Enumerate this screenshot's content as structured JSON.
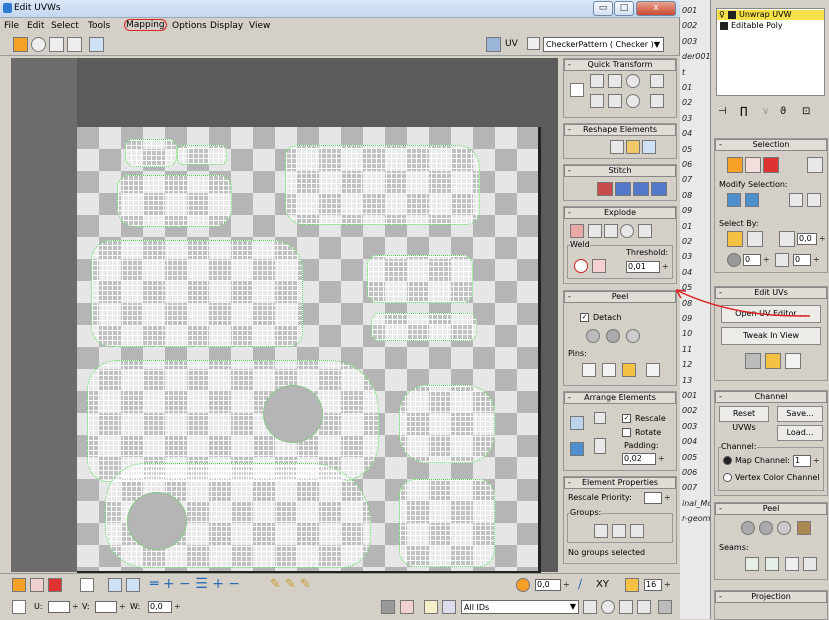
{
  "window": {
    "title": "Edit UVWs",
    "min_label": "▭",
    "max_label": "□",
    "close_label": "x"
  },
  "menu": {
    "items": [
      "File",
      "Edit",
      "Select",
      "Tools",
      "Mapping",
      "Options",
      "Display",
      "View"
    ]
  },
  "toolbar": {
    "uv_label": "UV",
    "pattern_dropdown": "CheckerPattern  ( Checker )"
  },
  "panel": {
    "quick_transform": "Quick Transform",
    "reshape_elements": "Reshape Elements",
    "stitch": "Stitch",
    "explode": "Explode",
    "weld": "Weld",
    "threshold_label": "Threshold:",
    "threshold_value": "0,01",
    "peel": "Peel",
    "detach_label": "Detach",
    "pins_label": "Pins:",
    "arrange_elements": "Arrange Elements",
    "rescale_label": "Rescale",
    "rotate_label": "Rotate",
    "padding_label": "Padding:",
    "padding_value": "0,02",
    "element_properties": "Element Properties",
    "rescale_priority_label": "Rescale Priority:",
    "groups_label": "Groups:",
    "no_groups_label": "No groups selected"
  },
  "bottombar": {
    "spin_value": "0,0",
    "xy_label": "XY",
    "grid_value": "16",
    "u_label": "U:",
    "v_label": "V:",
    "w_label": "W:",
    "w_value": "0,0",
    "ids_dropdown": "All IDs"
  },
  "background_list": {
    "items": [
      "001",
      "002",
      "003",
      "der001",
      "t",
      "01",
      "02",
      "03",
      "04",
      "05",
      "06",
      "07",
      "08",
      "09",
      "01",
      "02",
      "03",
      "04",
      "05",
      "08",
      "09",
      "10",
      "11",
      "12",
      "13",
      "001",
      "002",
      "003",
      "004",
      "005",
      "006",
      "007",
      "inal_Mo",
      "r-geoma"
    ]
  },
  "modifier_panel": {
    "stack": [
      "Unwrap UVW",
      "Editable Poly"
    ],
    "selection_title": "Selection",
    "modify_selection_label": "Modify Selection:",
    "select_by_label": "Select By:",
    "select_by_value1": "0,0",
    "select_by_value2": "0",
    "select_by_value3": "0",
    "edit_uvs_title": "Edit UVs",
    "open_uv_editor_label": "Open UV Editor ...",
    "tweak_in_view_label": "Tweak In View",
    "channel_title": "Channel",
    "reset_uvws_label": "Reset UVWs",
    "save_label": "Save...",
    "load_label": "Load...",
    "channel_group_label": "Channel:",
    "map_channel_label": "Map Channel:",
    "map_channel_value": "1",
    "vertex_color_channel_label": "Vertex Color Channel",
    "peel_title": "Peel",
    "seams_label": "Seams:",
    "projection_title": "Projection"
  },
  "colors": {
    "annotation": "#dd2222",
    "uv_edge": "#56d856",
    "highlight": "#f5c144"
  }
}
